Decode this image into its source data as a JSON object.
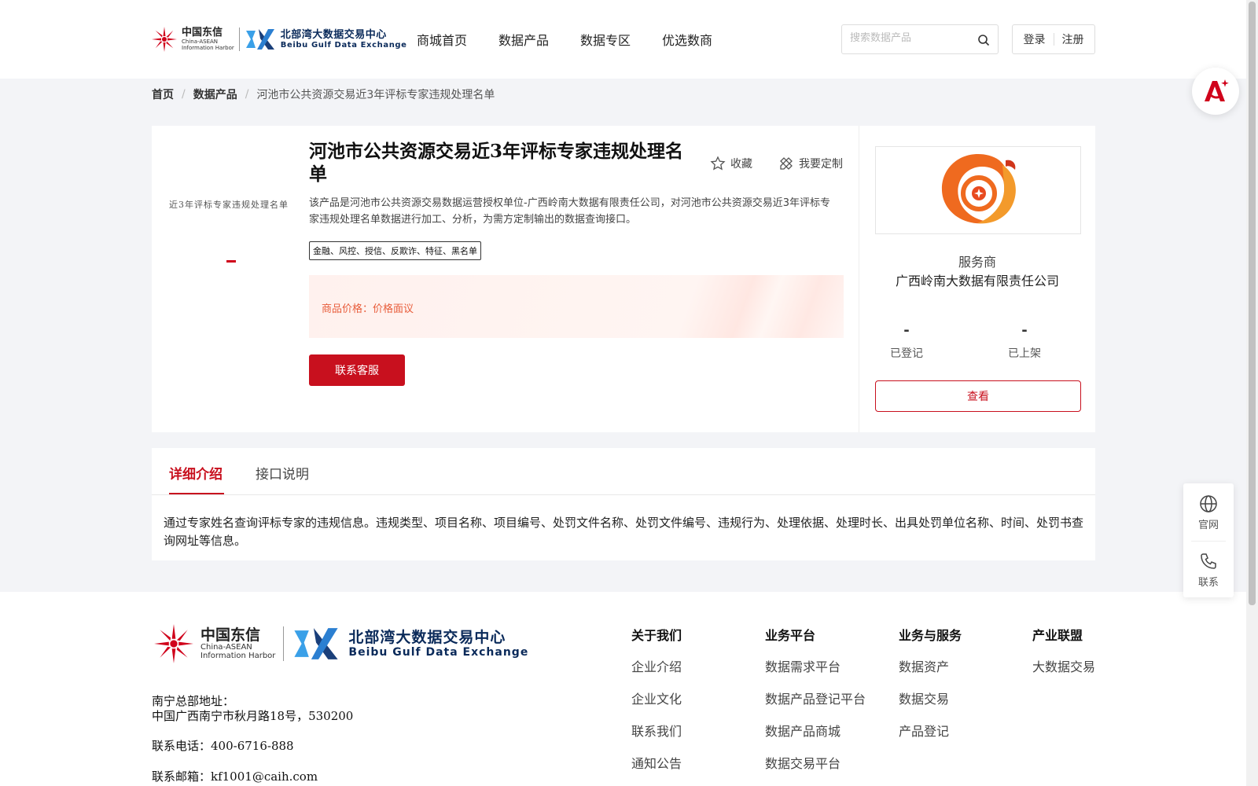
{
  "header": {
    "logo": {
      "cn": "中国东信",
      "en1": "China-ASEAN",
      "en2": "Information Harbor",
      "bgx_cn": "北部湾大数据交易中心",
      "bgx_en": "Beibu Gulf Data Exchange"
    },
    "nav": [
      "商城首页",
      "数据产品",
      "数据专区",
      "优选数商"
    ],
    "search_placeholder": "搜索数据产品",
    "login": "登录",
    "register": "注册"
  },
  "breadcrumb": {
    "home": "首页",
    "section": "数据产品",
    "current": "河池市公共资源交易近3年评标专家违规处理名单"
  },
  "product": {
    "thumb_text": "近3年评标专家违规处理名单",
    "title": "河池市公共资源交易近3年评标专家违规处理名单",
    "favorite": "收藏",
    "customize": "我要定制",
    "description": "该产品是河池市公共资源交易数据运营授权单位-广西岭南大数据有限责任公司，对河池市公共资源交易近3年评标专家违规处理名单数据进行加工、分析，为需方定制输出的数据查询接口。",
    "tags": "金融、风控、授信、反欺诈、特征、黑名单",
    "price_label": "商品价格：价格面议",
    "contact_button": "联系客服"
  },
  "provider": {
    "role": "服务商",
    "name": "广西岭南大数据有限责任公司",
    "registered_value": "-",
    "registered_label": "已登记",
    "listed_value": "-",
    "listed_label": "已上架",
    "view_button": "查看"
  },
  "tabs": {
    "items": [
      "详细介绍",
      "接口说明"
    ],
    "active": "详细介绍",
    "body": "通过专家姓名查询评标专家的违规信息。违规类型、项目名称、项目编号、处罚文件名称、处罚文件编号、违规行为、处理依据、处理时长、出具处罚单位名称、时间、处罚书查询网址等信息。"
  },
  "footer": {
    "address_label": "南宁总部地址：",
    "address": "中国广西南宁市秋月路18号，530200",
    "phone": "联系电话：400-6716-888",
    "email": "联系邮箱：kf1001@caih.com",
    "columns": [
      {
        "title": "关于我们",
        "items": [
          "企业介绍",
          "企业文化",
          "联系我们",
          "通知公告"
        ]
      },
      {
        "title": "业务平台",
        "items": [
          "数据需求平台",
          "数据产品登记平台",
          "数据产品商城",
          "数据交易平台"
        ]
      },
      {
        "title": "业务与服务",
        "items": [
          "数据资产",
          "数据交易",
          "产品登记"
        ]
      },
      {
        "title": "产业联盟",
        "items": [
          "大数据交易"
        ]
      }
    ]
  },
  "floating": {
    "website": "官网",
    "contact": "联系"
  },
  "colors": {
    "brand_red": "#c8101e",
    "price_orange": "#e85d3b",
    "bgx_navy": "#0a2a5a"
  }
}
